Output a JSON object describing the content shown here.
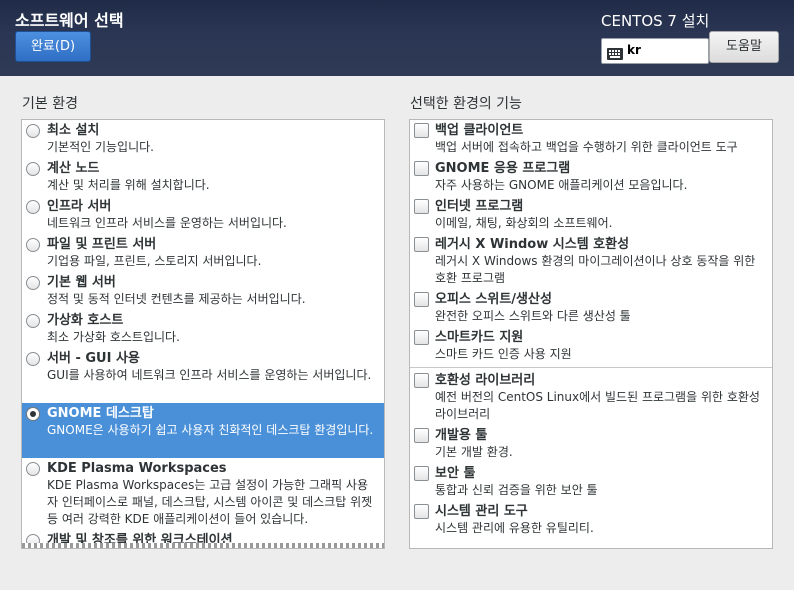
{
  "header": {
    "title": "소프트웨어 선택",
    "done_label": "완료(D)",
    "installer_title": "CENTOS 7 설치",
    "keyboard_layout": "kr",
    "help_label": "도움말"
  },
  "base_env": {
    "label": "기본 환경",
    "items": [
      {
        "title": "최소 설치",
        "desc": "기본적인 기능입니다.",
        "selected": false
      },
      {
        "title": "계산 노드",
        "desc": "계산 및 처리를 위해 설치합니다.",
        "selected": false
      },
      {
        "title": "인프라 서버",
        "desc": "네트워크 인프라 서비스를 운영하는 서버입니다.",
        "selected": false
      },
      {
        "title": "파일 및 프린트 서버",
        "desc": "기업용 파일, 프린트, 스토리지 서버입니다.",
        "selected": false
      },
      {
        "title": "기본 웹 서버",
        "desc": "정적 및 동적 인터넷 컨텐츠를 제공하는 서버입니다.",
        "selected": false
      },
      {
        "title": "가상화 호스트",
        "desc": "최소 가상화 호스트입니다.",
        "selected": false
      },
      {
        "title": "서버 - GUI 사용",
        "desc": "GUI를 사용하여 네트워크 인프라 서비스를 운영하는 서버입니다.",
        "selected": false
      },
      {
        "title": "GNOME 데스크탑",
        "desc": "GNOME은 사용하기 쉽고 사용자 친화적인 데스크탑 환경입니다.",
        "selected": true
      },
      {
        "title": "KDE Plasma Workspaces",
        "desc": "KDE Plasma Workspaces는 고급 설정이 가능한 그래픽 사용자 인터페이스로 패널, 데스크탑, 시스템 아이콘 및 데스크탑 위젯 등 여러 강력한 KDE 애플리케이션이 들어 있습니다.",
        "selected": false
      },
      {
        "title": "개발 및 창조를 위한 워크스테이션",
        "desc": "",
        "selected": false
      }
    ]
  },
  "addons": {
    "label": "선택한 환경의 기능",
    "items": [
      {
        "title": "백업 클라이언트",
        "desc": "백업 서버에 접속하고 백업을 수행하기 위한 클라이언트 도구",
        "checked": false
      },
      {
        "title": "GNOME 응용 프로그램",
        "desc": "자주 사용하는 GNOME 애플리케이션 모음입니다.",
        "checked": false
      },
      {
        "title": "인터넷 프로그램",
        "desc": "이메일, 채팅, 화상회의 소프트웨어.",
        "checked": false
      },
      {
        "title": "레거시 X Window 시스템 호환성",
        "desc": "레거시 X Windows 환경의 마이그레이션이나 상호 동작을 위한 호환 프로그램",
        "checked": false
      },
      {
        "title": "오피스 스위트/생산성",
        "desc": "완전한 오피스 스위트와 다른 생산성 툴",
        "checked": false
      },
      {
        "title": "스마트카드 지원",
        "desc": "스마트 카드 인증 사용 지원",
        "checked": false
      },
      {
        "title": "호환성 라이브러리",
        "desc": "예전 버전의 CentOS Linux에서 빌드된 프로그램을 위한 호환성 라이브러리",
        "checked": false
      },
      {
        "title": "개발용 툴",
        "desc": "기본 개발 환경.",
        "checked": false
      },
      {
        "title": "보안 툴",
        "desc": "통합과 신뢰 검증을 위한 보안 툴",
        "checked": false
      },
      {
        "title": "시스템 관리 도구",
        "desc": "시스템 관리에 유용한 유틸리티.",
        "checked": false
      }
    ]
  },
  "icons": {
    "keyboard": "keyboard-icon"
  }
}
